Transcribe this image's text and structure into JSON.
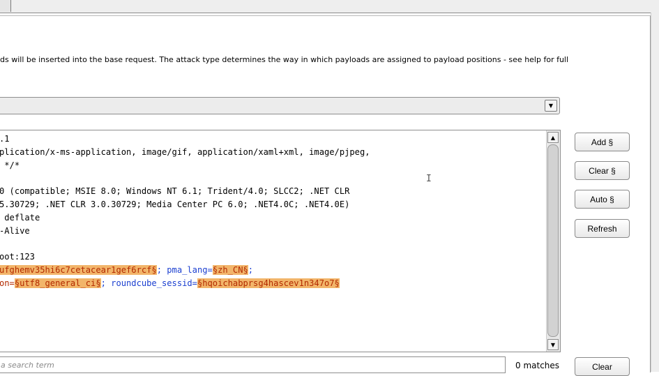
{
  "description": "ds will be inserted into the base request. The attack type determines the way in which payloads are assigned to payload positions - see help for full",
  "request_lines": [
    {
      "segments": [
        {
          "t": ".1",
          "c": ""
        }
      ]
    },
    {
      "segments": [
        {
          "t": "plication/x-ms-application, image/gif, application/xaml+xml, image/pjpeg,",
          "c": ""
        }
      ]
    },
    {
      "segments": [
        {
          "t": " */*",
          "c": ""
        }
      ]
    },
    {
      "segments": [
        {
          "t": "",
          "c": ""
        }
      ]
    },
    {
      "segments": [
        {
          "t": "0 (compatible; MSIE 8.0; Windows NT 6.1; Trident/4.0; SLCC2; .NET CLR",
          "c": ""
        }
      ]
    },
    {
      "segments": [
        {
          "t": "5.30729; .NET CLR 3.0.30729; Media Center PC 6.0; .NET4.0C; .NET4.0E)",
          "c": ""
        }
      ]
    },
    {
      "segments": [
        {
          "t": " deflate",
          "c": ""
        }
      ]
    },
    {
      "segments": [
        {
          "t": "-Alive",
          "c": ""
        }
      ]
    },
    {
      "segments": [
        {
          "t": "",
          "c": ""
        }
      ]
    },
    {
      "segments": [
        {
          "t": "oot:123",
          "c": ""
        }
      ]
    },
    {
      "segments": [
        {
          "t": "ufghemv35hi6c7cetacear1gef6rcf§",
          "c": "mk"
        },
        {
          "t": "; pma_lang=",
          "c": "pk"
        },
        {
          "t": "§zh_CN§",
          "c": "mk"
        },
        {
          "t": ";",
          "c": "pk"
        }
      ]
    },
    {
      "segments": [
        {
          "t": "on=",
          "c": "pv"
        },
        {
          "t": "§utf8_general_ci§",
          "c": "mk"
        },
        {
          "t": "; roundcube_sessid=",
          "c": "pk"
        },
        {
          "t": "§hqoichabprsg4hascev1n347o7§",
          "c": "mk"
        }
      ]
    }
  ],
  "buttons": {
    "add": "Add §",
    "clear_marks": "Clear §",
    "auto": "Auto §",
    "refresh": "Refresh",
    "clear": "Clear"
  },
  "search": {
    "placeholder": "a search term"
  },
  "matches_text": "0 matches",
  "icons": {
    "dropdown": "chevron-down-icon",
    "scroll_up": "arrow-up-icon",
    "scroll_down": "arrow-down-icon"
  }
}
